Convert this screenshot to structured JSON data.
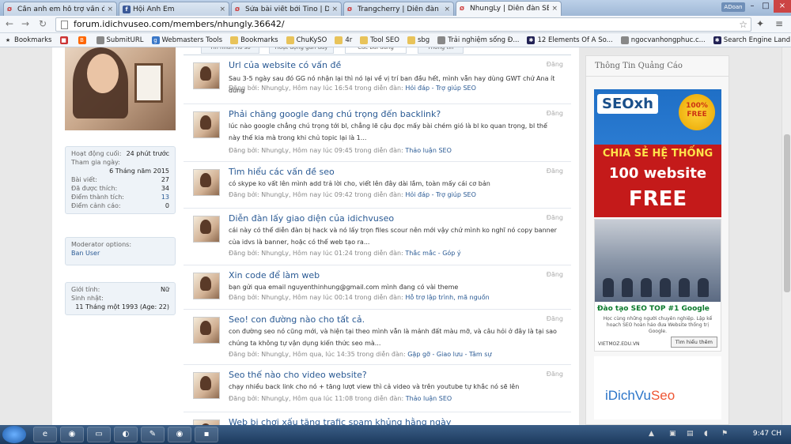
{
  "browser": {
    "tabs": [
      {
        "title": "Cần anh em hỗ trợ vấn đề"
      },
      {
        "title": "Hội Anh Em"
      },
      {
        "title": "Sửa bài viết bởi Tino | Diễ"
      },
      {
        "title": "Trangcherry | Diễn đàn Sẽ"
      },
      {
        "title": "NhungLy | Diễn đàn SEO c"
      }
    ],
    "user_badge": "ADoan",
    "url": "forum.idichvuseo.com/members/nhungly.36642/",
    "bookmarks": [
      "Bookmarks",
      "SubmitURL",
      "Webmasters Tools",
      "Bookmarks",
      "ChuKySO",
      "4r",
      "Tool SEO",
      "sbg",
      "Trải nghiệm sống Đ...",
      "12 Elements Of A So...",
      "ngocvanhongphuc.c...",
      "Search Engine Land"
    ]
  },
  "profile": {
    "stats": [
      {
        "label": "Hoạt động cuối:",
        "value": "24 phút trước"
      },
      {
        "label": "Tham gia ngày:",
        "value": ""
      },
      {
        "label": "",
        "value": "6 Tháng năm 2015"
      },
      {
        "label": "Bài viết:",
        "value": "27"
      },
      {
        "label": "Đã được thích:",
        "value": "34"
      },
      {
        "label": "Điểm thành tích:",
        "value": "13"
      },
      {
        "label": "Điểm cảnh cáo:",
        "value": "0"
      }
    ],
    "moderator_title": "Moderator options:",
    "ban_user": "Ban User",
    "gender_label": "Giới tính:",
    "gender_value": "Nữ",
    "birthday_label": "Sinh nhật:",
    "birthday_value": "11 Tháng một 1993 (Age: 22)"
  },
  "profile_tabs": [
    "Tin nhắn hồ sơ",
    "Hoạt động gần đây",
    "Các bài đăng",
    "Thông tin"
  ],
  "posts": [
    {
      "title": "Url của website có vấn đề",
      "status": "Đăng",
      "excerpt": "Sau 3-5 ngày sau đó GG nó nhận lại thì nó lại về vị trí ban đầu hết, mình vẫn hay dùng GWT chứ Ana ít dùng",
      "meta": "Đăng bởi: NhungLy, Hôm nay lúc 16:54 trong diễn đàn:",
      "forum": "Hỏi đáp - Trợ giúp SEO"
    },
    {
      "title": "Phải chăng google đang chú trọng đến backlink?",
      "status": "Đăng",
      "excerpt": "lúc nào google chẳng chú trọng tới bl, chẳng lẽ cậu đọc mấy bài chém gió là bl ko quan trọng, bl thế này thế kia mà trong khi chủ topic lại là 1...",
      "meta": "Đăng bởi: NhungLy, Hôm nay lúc 09:45 trong diễn đàn:",
      "forum": "Thảo luận SEO"
    },
    {
      "title": "Tìm hiểu các vấn đề seo",
      "status": "Đăng",
      "excerpt": "có skype ko vất lên mình add trả lời cho, viết lên đây dài lắm, toàn mấy cái cơ bản",
      "meta": "Đăng bởi: NhungLy, Hôm nay lúc 09:42 trong diễn đàn:",
      "forum": "Hỏi đáp - Trợ giúp SEO"
    },
    {
      "title": "Diễn đàn lấy giao diện của idichvuseo",
      "status": "Đăng",
      "excerpt": "cái này có thể diễn đàn bị hack và nó lấy trọn files scour nên mới vậy chứ mình ko nghĩ nó copy banner của idvs là banner, hoặc có thể web tạo ra...",
      "meta": "Đăng bởi: NhungLy, Hôm nay lúc 01:24 trong diễn đàn:",
      "forum": "Thắc mắc - Góp ý"
    },
    {
      "title": "Xin code để làm web",
      "status": "Đăng",
      "excerpt": "bạn gửi qua email nguyenthinhung@gmail.com mình đang có vài theme",
      "meta": "Đăng bởi: NhungLy, Hôm nay lúc 00:14 trong diễn đàn:",
      "forum": "Hỗ trợ lập trình, mã nguồn"
    },
    {
      "title": "Seo! con đường nào cho tất cả.",
      "status": "Đăng",
      "excerpt": "con đường seo nó cũng mới, và hiện tại theo mình vẫn là mảnh đất màu mỡ, và câu hỏi ở đây là tại sao chúng ta không tự vận dụng kiến thức seo mà...",
      "meta": "Đăng bởi: NhungLy, Hôm qua, lúc 14:35 trong diễn đàn:",
      "forum": "Gặp gỡ - Giao lưu - Tâm sự"
    },
    {
      "title": "Seo thế nào cho video website?",
      "status": "Đăng",
      "excerpt": "chạy nhiều back link cho nó + tăng lượt view thì cả video và trên youtube tự khắc nó sẽ lên",
      "meta": "Đăng bởi: NhungLy, Hôm qua lúc 11:08 trong diễn đàn:",
      "forum": "Thảo luận SEO"
    },
    {
      "title": "Web bị chơi xấu tặng trafic spam khủng hằng ngày",
      "status": "",
      "excerpt": "",
      "meta": "",
      "forum": ""
    }
  ],
  "sidebar": {
    "heading": "Thông Tin Quảng Cáo",
    "ad1": {
      "logo": "SEOxh",
      "badge_pct": "100%",
      "badge_txt": "FREE",
      "line1": "CHIA SẺ HỆ THỐNG",
      "line2": "100 website",
      "line3": "FREE"
    },
    "ad2": {
      "headline": "Đào tạo SEO TOP #1 Google",
      "body": "Học cùng những người chuyên nghiệp. Lập kế hoạch SEO hoàn hảo đưa Website thống trị Google.",
      "domain": "VIETMOZ.EDU.VN",
      "button": "Tìm hiểu thêm"
    },
    "ad3": {
      "logo_a": "iDichVu",
      "logo_b": "Seo"
    }
  },
  "taskbar": {
    "time": "9:47 CH",
    "lang": "EN"
  },
  "colors": {
    "link": "#2a5a94",
    "tab_bg": "#bcd0e8"
  }
}
